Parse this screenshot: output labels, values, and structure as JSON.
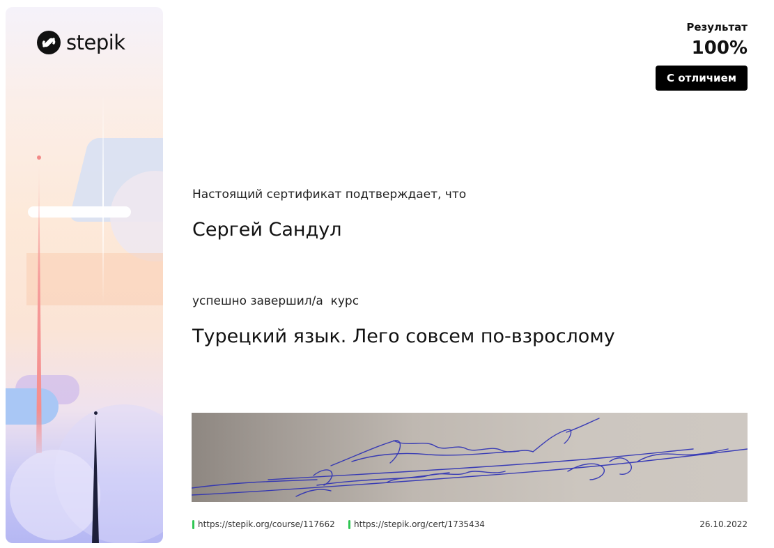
{
  "brand": {
    "name": "stepik"
  },
  "result": {
    "label": "Результат",
    "value": "100%",
    "badge": "С отличием"
  },
  "certificate": {
    "intro": "Настоящий сертификат подтверждает, что",
    "recipient": "Сергей Сандул",
    "completed_text": "успешно завершил/а  курс",
    "course_title": "Турецкий язык. Лего совсем по-взрослому"
  },
  "footer": {
    "course_link": "https://stepik.org/course/117662",
    "cert_link": "https://stepik.org/cert/1735434",
    "date": "26.10.2022"
  },
  "colors": {
    "badge_bg": "#000000",
    "link_marker": "#2fc653",
    "signature_ink": "#2b2fb5"
  }
}
